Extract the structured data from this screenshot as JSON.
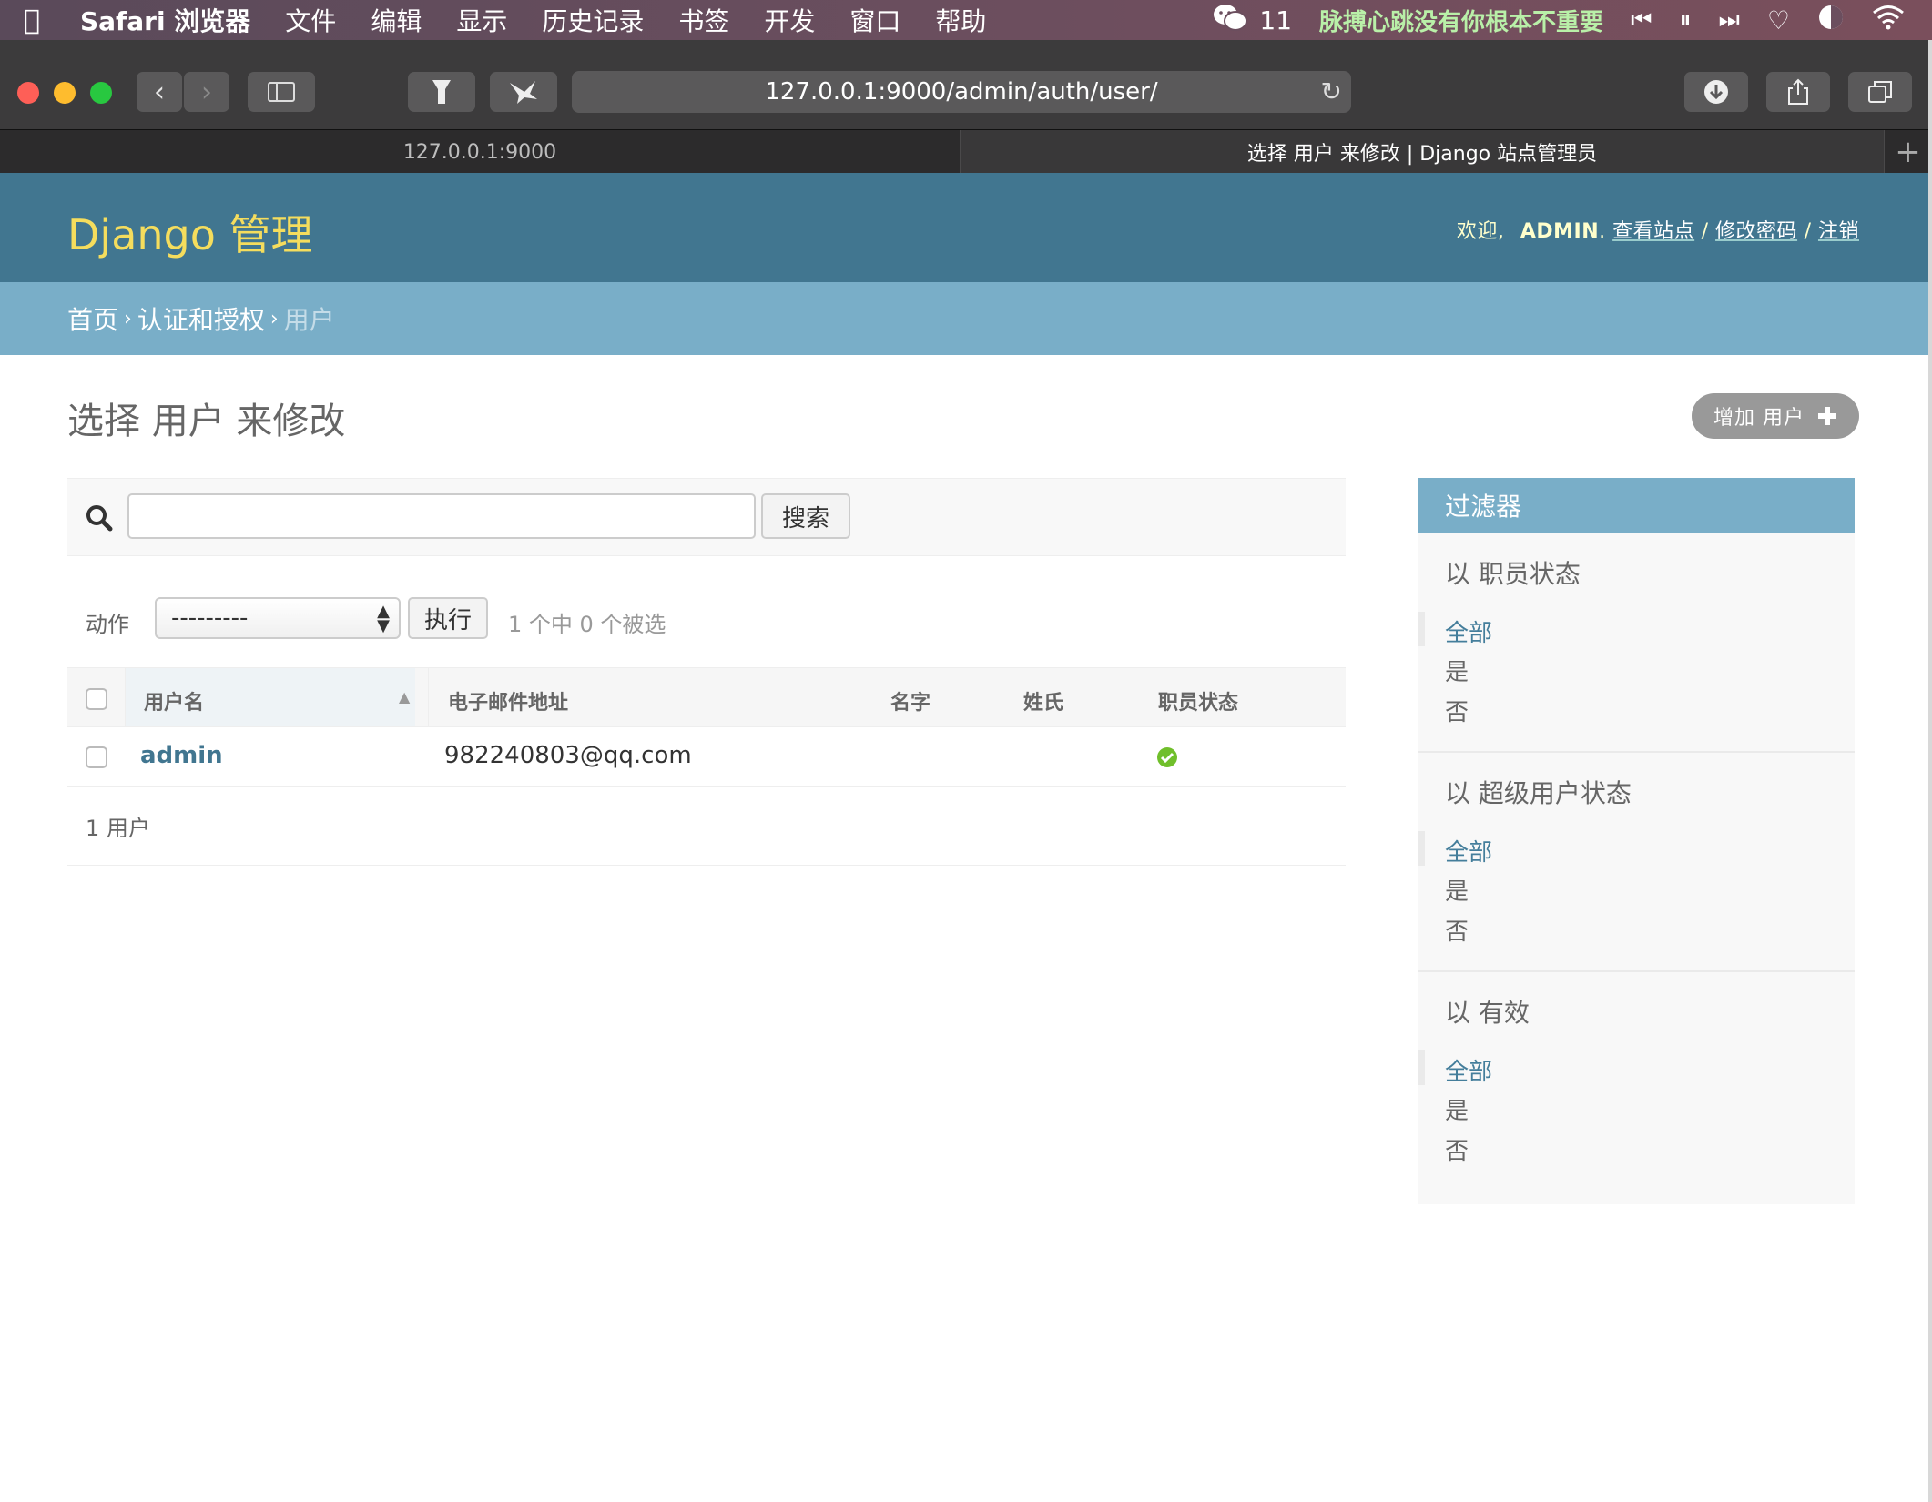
{
  "menubar": {
    "app_name": "Safari 浏览器",
    "items": [
      "文件",
      "编辑",
      "显示",
      "历史记录",
      "书签",
      "开发",
      "窗口",
      "帮助"
    ],
    "wechat_count": "11",
    "now_playing": "脉搏心跳没有你根本不重要"
  },
  "browser": {
    "url": "127.0.0.1:9000/admin/auth/user/",
    "tabs": [
      {
        "label": "127.0.0.1:9000"
      },
      {
        "label": "选择 用户 来修改 | Django 站点管理员"
      }
    ]
  },
  "header": {
    "brand": "Django 管理",
    "welcome": "欢迎,",
    "username": "ADMIN",
    "view_site": "查看站点",
    "change_password": "修改密码",
    "logout": "注销",
    "sep": "/"
  },
  "breadcrumbs": {
    "home": "首页",
    "section": "认证和授权",
    "current": "用户",
    "sep": "›"
  },
  "content": {
    "title": "选择 用户 来修改",
    "add_button": "增加 用户",
    "search_button": "搜索",
    "action_label": "动作",
    "action_selected": "---------",
    "go_button": "执行",
    "selection_counter": "1 个中 0 个被选",
    "columns": [
      "用户名",
      "电子邮件地址",
      "名字",
      "姓氏",
      "职员状态"
    ],
    "rows": [
      {
        "username": "admin",
        "email": "982240803@qq.com",
        "first_name": "",
        "last_name": "",
        "is_staff": true
      }
    ],
    "result_count": "1 用户"
  },
  "filter": {
    "title": "过滤器",
    "groups": [
      {
        "heading": "以 职员状态",
        "options": [
          "全部",
          "是",
          "否"
        ]
      },
      {
        "heading": "以 超级用户状态",
        "options": [
          "全部",
          "是",
          "否"
        ]
      },
      {
        "heading": "以 有效",
        "options": [
          "全部",
          "是",
          "否"
        ]
      }
    ]
  },
  "colors": {
    "header": "#417690",
    "breadcrumbs": "#79aec8",
    "brand": "#f5dd5d",
    "link": "#447e9b",
    "success": "#70bf2b"
  }
}
